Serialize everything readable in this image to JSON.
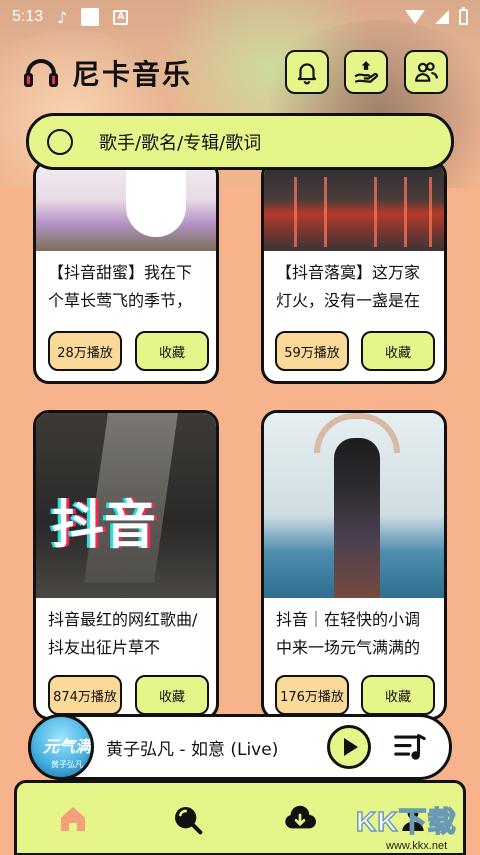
{
  "status_bar": {
    "time": "5:13",
    "a_badge": "A"
  },
  "header": {
    "app_name": "尼卡音乐",
    "buttons": [
      {
        "icon": "bell-icon"
      },
      {
        "icon": "vip-hand-icon"
      },
      {
        "icon": "users-icon"
      }
    ]
  },
  "search": {
    "placeholder": "歌手/歌名/专辑/歌词"
  },
  "cards": [
    {
      "desc": "【抖音甜蜜】我在下个草长莺飞的季节，",
      "plays": "28万播放",
      "fav": "收藏"
    },
    {
      "desc": "【抖音落寞】这万家灯火，没有一盏是在",
      "plays": "59万播放",
      "fav": "收藏"
    },
    {
      "desc": "抖音最红的网红歌曲/抖友出征片草不",
      "plays": "874万播放",
      "fav": "收藏",
      "image_text": "抖音"
    },
    {
      "desc": "抖音｜在轻快的小调中来一场元气满满的",
      "plays": "176万播放",
      "fav": "收藏"
    }
  ],
  "player": {
    "song": "黄子弘凡 - 如意 (Live)",
    "album_text": "元气满",
    "album_sub": "黄子弘凡"
  },
  "bottom_nav": {
    "items": [
      {
        "icon": "home-icon",
        "active": true
      },
      {
        "icon": "search-icon"
      },
      {
        "icon": "download-cloud-icon"
      },
      {
        "icon": "profile-icon"
      }
    ]
  },
  "watermark": {
    "big": "KK下载",
    "small": "www.kkx.net"
  },
  "colors": {
    "background": "#f7b48c",
    "accent_lime": "#e6f58a",
    "plays_pill": "#fbd998",
    "home_active": "#f4a07a"
  }
}
